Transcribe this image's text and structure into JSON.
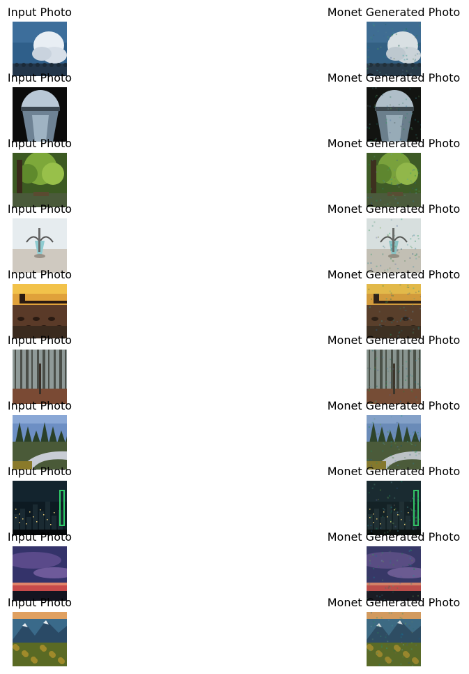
{
  "columns": [
    {
      "title": "Input Photo"
    },
    {
      "title": "Monet Generated Photo"
    }
  ],
  "rows": [
    {
      "scene": "cloud-sky",
      "input_label": "Input Photo",
      "output_label": "Monet Generated Photo"
    },
    {
      "scene": "tunnel-canal",
      "input_label": "Input Photo",
      "output_label": "Monet Generated Photo"
    },
    {
      "scene": "green-tree",
      "input_label": "Input Photo",
      "output_label": "Monet Generated Photo"
    },
    {
      "scene": "beach-boat",
      "input_label": "Input Photo",
      "output_label": "Monet Generated Photo"
    },
    {
      "scene": "sunset-pier",
      "input_label": "Input Photo",
      "output_label": "Monet Generated Photo"
    },
    {
      "scene": "misty-forest",
      "input_label": "Input Photo",
      "output_label": "Monet Generated Photo"
    },
    {
      "scene": "road-trees",
      "input_label": "Input Photo",
      "output_label": "Monet Generated Photo"
    },
    {
      "scene": "night-city",
      "input_label": "Input Photo",
      "output_label": "Monet Generated Photo"
    },
    {
      "scene": "purple-sunset",
      "input_label": "Input Photo",
      "output_label": "Monet Generated Photo"
    },
    {
      "scene": "mountain-valley",
      "input_label": "Input Photo",
      "output_label": "Monet Generated Photo"
    }
  ]
}
